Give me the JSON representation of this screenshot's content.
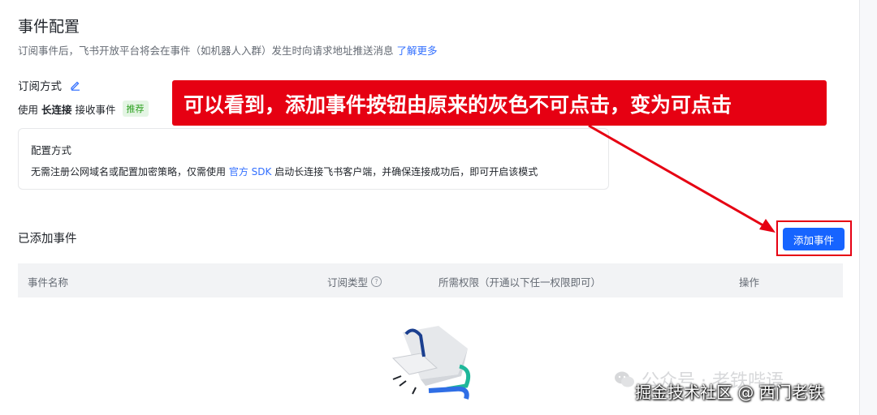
{
  "page": {
    "title": "事件配置",
    "description": "订阅事件后，飞书开放平台将会在事件（如机器人入群）发生时向请求地址推送消息",
    "learn_more": "了解更多"
  },
  "subscription": {
    "title": "订阅方式",
    "method_prefix": "使用",
    "method_bold": "长连接",
    "method_suffix": "接收事件",
    "tag": "推荐"
  },
  "config": {
    "title": "配置方式",
    "desc_prefix": "无需注册公网域名或配置加密策略，仅需使用",
    "sdk_link": "官方 SDK",
    "desc_suffix": "启动长连接飞书客户端，并确保连接成功后，即可开启该模式"
  },
  "events": {
    "title": "已添加事件",
    "add_button": "添加事件",
    "columns": [
      "事件名称",
      "订阅类型",
      "所需权限（开通以下任一权限即可）",
      "操作"
    ]
  },
  "annotation": {
    "text": "可以看到，添加事件按钮由原来的灰色不可点击，变为可点击",
    "color": "#e60012"
  },
  "watermarks": {
    "wechat": "公众号 · 老铁哔语",
    "juejin": "掘金技术社区 @ 西门老铁"
  },
  "icons": {
    "edit": "edit-pencil-icon",
    "help": "question-circle-icon",
    "empty": "empty-state-illustration",
    "wechat": "wechat-logo-icon"
  }
}
